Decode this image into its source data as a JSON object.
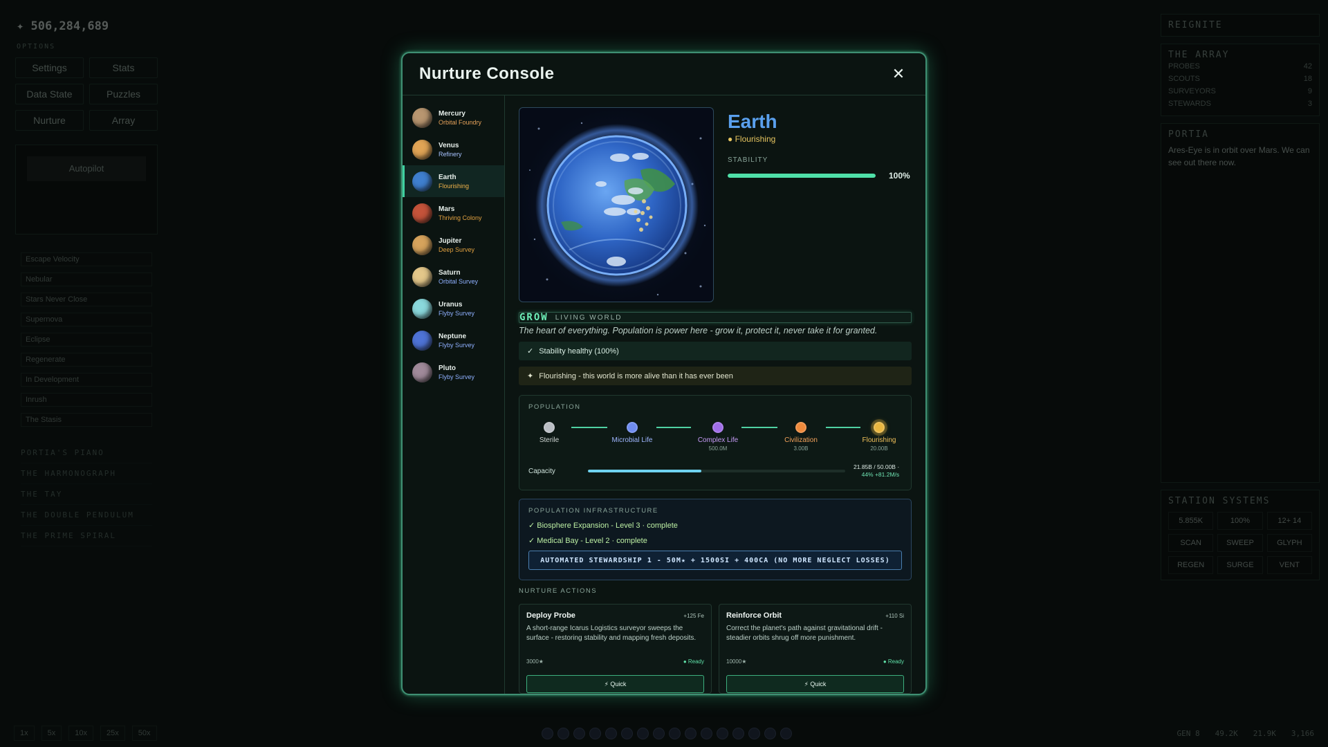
{
  "background": {
    "credits": "506,284,689",
    "options_label": "OPTIONS",
    "buttons": [
      "Settings",
      "Stats",
      "Data State",
      "Puzzles",
      "Nurture",
      "Array"
    ],
    "panel_label": "Autopilot",
    "list": [
      "Escape Velocity",
      "Nebular",
      "Stars Never Close",
      "Supernova",
      "Eclipse",
      "Regenerate",
      "In Development",
      "Inrush",
      "The Stasis"
    ],
    "rows": [
      "PORTIA'S PIANO",
      "THE HARMONOGRAPH",
      "THE TAY",
      "THE DOUBLE PENDULUM",
      "THE PRIME SPIRAL"
    ],
    "right_title": "REIGNITE",
    "array_title": "THE ARRAY",
    "array_rows": [
      [
        "PROBES",
        "42"
      ],
      [
        "SCOUTS",
        "18"
      ],
      [
        "SURVEYORS",
        "9"
      ],
      [
        "STEWARDS",
        "3"
      ]
    ],
    "comms_title": "PORTIA",
    "comms_text": "Ares-Eye is in orbit over Mars. We can see out there now.",
    "systems_title": "STATION SYSTEMS",
    "systems": [
      "5.855K",
      "100%",
      "12+ 14",
      "SCAN",
      "SWEEP",
      "GLYPH",
      "REGEN",
      "SURGE",
      "VENT"
    ],
    "speeds": [
      "1x",
      "5x",
      "10x",
      "25x",
      "50x"
    ],
    "resources": [
      "GEN 8",
      "49.2K",
      "21.9K",
      "3,166"
    ]
  },
  "modal": {
    "title": "Nurture Console",
    "close_icon": "close-icon"
  },
  "planets": [
    {
      "name": "Mercury",
      "status": "Orbital Foundry",
      "status_color": "#e6a25a",
      "color": "#b89670"
    },
    {
      "name": "Venus",
      "status": "Refinery",
      "status_color": "#a7c3ff",
      "color": "#e0a455"
    },
    {
      "name": "Earth",
      "status": "Flourishing",
      "status_color": "#f0b24a",
      "color": "#3f7fcf"
    },
    {
      "name": "Mars",
      "status": "Thriving Colony",
      "status_color": "#e0a040",
      "color": "#c4533a"
    },
    {
      "name": "Jupiter",
      "status": "Deep Survey",
      "status_color": "#e0a040",
      "color": "#d6a35c"
    },
    {
      "name": "Saturn",
      "status": "Orbital Survey",
      "status_color": "#8fb0ff",
      "color": "#e3c78a"
    },
    {
      "name": "Uranus",
      "status": "Flyby Survey",
      "status_color": "#8fb0ff",
      "color": "#8ad8dc"
    },
    {
      "name": "Neptune",
      "status": "Flyby Survey",
      "status_color": "#8fb0ff",
      "color": "#4e73d6"
    },
    {
      "name": "Pluto",
      "status": "Flyby Survey",
      "status_color": "#8fb0ff",
      "color": "#a08a9a"
    }
  ],
  "selected": {
    "name": "Earth",
    "status": "Flourishing",
    "stability_label": "STABILITY",
    "stability": 100,
    "stability_text": "100%",
    "grow_word": "GROW",
    "grow_sub": "LIVING WORLD",
    "description": "The heart of everything. Population is power here - grow it, protect it, never take it for granted.",
    "messages": [
      {
        "glyph": "✓",
        "text": "Stability healthy (100%)"
      },
      {
        "glyph": "✦",
        "text": "Flourishing - this world is more alive than it has ever been"
      }
    ]
  },
  "population": {
    "label": "POPULATION",
    "stages": [
      {
        "name": "Sterile",
        "value": "",
        "color": "#b9bec4",
        "text_color": "#cfd6d4"
      },
      {
        "name": "Microbial Life",
        "value": "",
        "color": "#6f8cf0",
        "text_color": "#9fb6ff"
      },
      {
        "name": "Complex Life",
        "value": "500.0M",
        "color": "#a06ee8",
        "text_color": "#c79cf7"
      },
      {
        "name": "Civilization",
        "value": "3.00B",
        "color": "#ee8a3c",
        "text_color": "#f3a25b"
      },
      {
        "name": "Flourishing",
        "value": "20.00B",
        "color": "#e9b640",
        "text_color": "#f0c05a"
      }
    ],
    "capacity_label": "Capacity",
    "capacity_fraction": 0.44,
    "capacity_text": "21.85B / 50.00B ·",
    "capacity_rate": "44% +81.2M/s"
  },
  "infrastructure": {
    "label": "POPULATION INFRASTRUCTURE",
    "items": [
      "✓ Biosphere Expansion - Level 3 · complete",
      "✓ Medical Bay - Level 2 · complete"
    ],
    "steward_button": "AUTOMATED STEWARDSHIP 1 - 50M★ + 1500SI + 400CA (NO MORE NEGLECT LOSSES)"
  },
  "actions": {
    "label": "NURTURE ACTIONS",
    "items": [
      {
        "title": "Deploy Probe",
        "cost": "+125 Fe",
        "desc": "A short-range Icarus Logistics surveyor sweeps the surface - restoring stability and mapping fresh deposits.",
        "price": "3000★",
        "status": "● Ready",
        "button": "⚡ Quick"
      },
      {
        "title": "Reinforce Orbit",
        "cost": "+110 Si",
        "desc": "Correct the planet's path against gravitational drift - steadier orbits shrug off more punishment.",
        "price": "10000★",
        "status": "● Ready",
        "button": "⚡ Quick"
      }
    ]
  }
}
